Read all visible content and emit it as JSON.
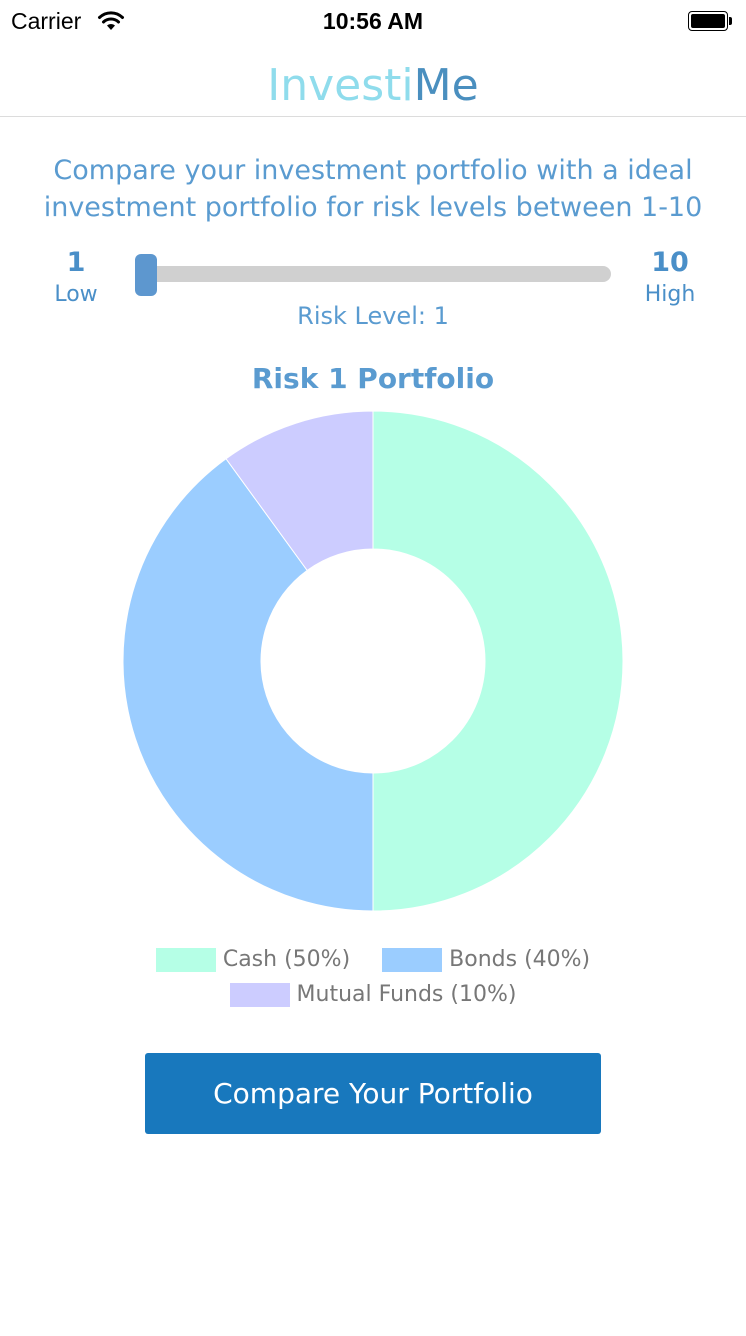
{
  "status_bar": {
    "carrier": "Carrier",
    "time": "10:56 AM"
  },
  "nav": {
    "brand_part1": "Investi",
    "brand_part2": "Me"
  },
  "intro": "Compare your investment portfolio with a ideal investment portfolio for risk levels between 1-10",
  "slider": {
    "min_value": "1",
    "min_label": "Low",
    "max_value": "10",
    "max_label": "High",
    "current": 1,
    "min": 1,
    "max": 10,
    "risk_label": "Risk Level: 1"
  },
  "chart_title": "Risk 1 Portfolio",
  "chart_data": {
    "type": "pie",
    "donut": true,
    "title": "Risk 1 Portfolio",
    "categories": [
      "Cash",
      "Bonds",
      "Mutual Funds"
    ],
    "values": [
      50,
      40,
      10
    ],
    "colors": [
      "#b5ffe6",
      "#9bcdff",
      "#ccccff"
    ],
    "legend_labels": [
      "Cash (50%)",
      "Bonds (40%)",
      "Mutual Funds (10%)"
    ]
  },
  "legend": [
    {
      "label": "Cash (50%)",
      "color": "#b5ffe6"
    },
    {
      "label": "Bonds (40%)",
      "color": "#9bcdff"
    },
    {
      "label": "Mutual Funds (10%)",
      "color": "#ccccff"
    }
  ],
  "compare_button": "Compare Your Portfolio",
  "colors": {
    "accent": "#1878bd",
    "text_blue": "#5a9bd0",
    "brand_light": "#8fdcec",
    "brand_dark": "#4a8fbf"
  }
}
